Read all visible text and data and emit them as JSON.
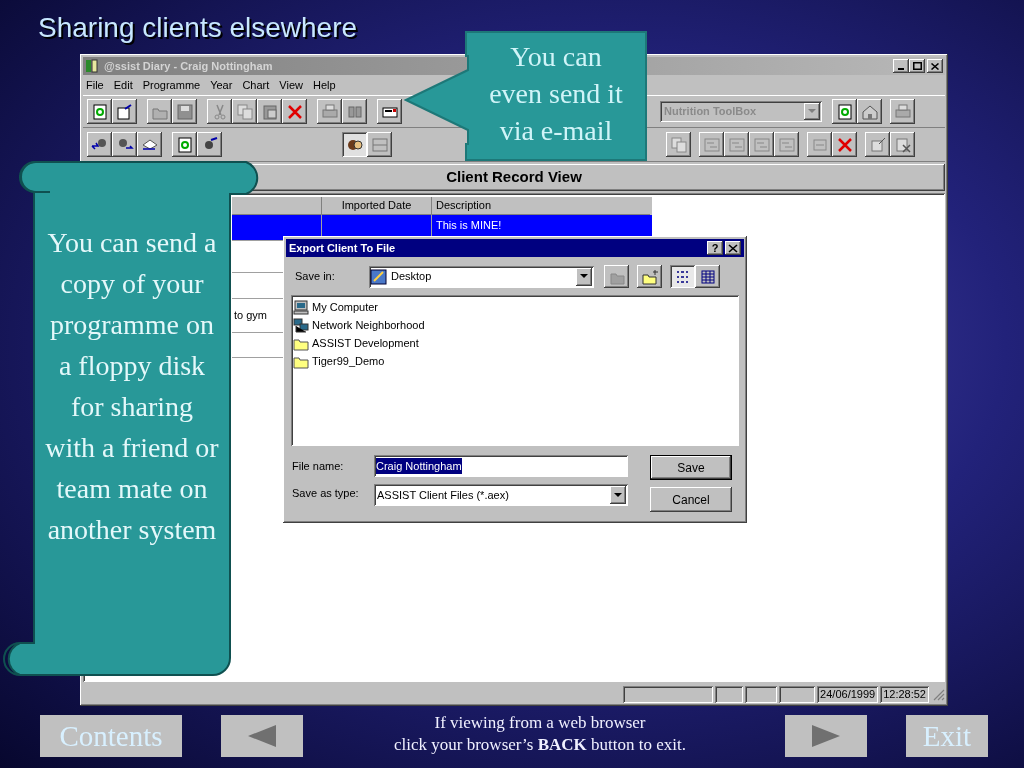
{
  "slide_title": "Sharing clients elsewhere",
  "app": {
    "title": "@ssist Diary - Craig Nottingham",
    "menu": [
      "File",
      "Edit",
      "Programme",
      "Year",
      "Chart",
      "View",
      "Help"
    ],
    "toolbox": {
      "value": "Nutrition ToolBox",
      "disabled": true
    },
    "view_title": "Client Record View",
    "table": {
      "columns": [
        "Imported Date",
        "Description"
      ],
      "rows": [
        {
          "selected": true,
          "description": "This is MINE!"
        },
        {
          "selected": false
        },
        {
          "selected": false
        },
        {
          "selected": false,
          "column_1": "to gym"
        },
        {
          "selected": false
        }
      ]
    },
    "status_bar": [
      "24/06/1999",
      "12:28:52"
    ]
  },
  "dialog": {
    "title": "Export Client To File",
    "help_button": "?",
    "save_in_label": "Save in:",
    "save_in_value": "Desktop",
    "items": [
      {
        "kind": "computer",
        "label": "My Computer"
      },
      {
        "kind": "network",
        "label": "Network Neighborhood"
      },
      {
        "kind": "folder",
        "label": "ASSIST Development"
      },
      {
        "kind": "folder",
        "label": "Tiger99_Demo"
      }
    ],
    "file_name_label": "File name:",
    "file_name": "Craig Nottingham",
    "type_label": "Save as type:",
    "type_value": "ASSIST Client Files (*.aex)",
    "buttons": [
      "Save",
      "Cancel"
    ]
  },
  "callouts": [
    {
      "kind": "arrow",
      "text": "You can even send it via e-mail"
    },
    {
      "kind": "scroll",
      "text": "You can send a copy of your programme on a floppy disk for sharing with a friend or team mate on another system"
    }
  ],
  "nav": {
    "contents": "Contents",
    "exit": "Exit",
    "note_lines": [
      "If viewing from a web browser",
      "click your browser’s **BACK** button to exit."
    ]
  }
}
